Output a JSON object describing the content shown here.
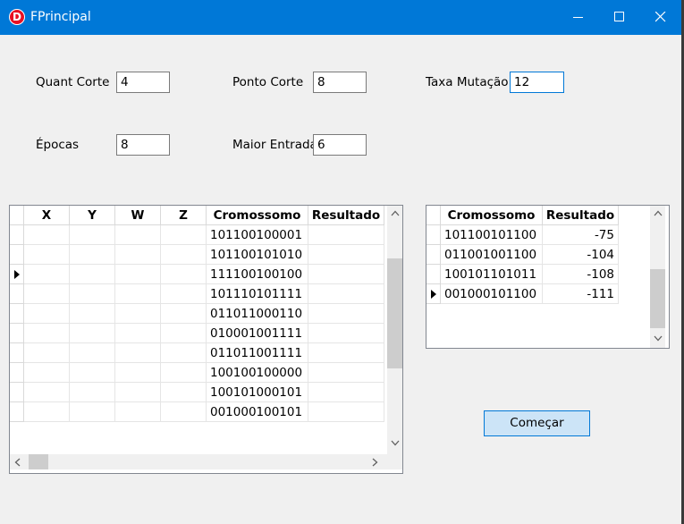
{
  "window": {
    "title": "FPrincipal",
    "icon": "app-d-icon",
    "accent": "#0078d7"
  },
  "form": {
    "quant_corte": {
      "label": "Quant Corte",
      "value": "4"
    },
    "ponto_corte": {
      "label": "Ponto Corte",
      "value": "8"
    },
    "taxa_mutacao": {
      "label": "Taxa Mutação",
      "value": "12"
    },
    "epocas": {
      "label": "Épocas",
      "value": "8"
    },
    "maior_entrada": {
      "label": "Maior Entrada",
      "value": "6"
    }
  },
  "population_grid": {
    "columns": [
      "X",
      "Y",
      "W",
      "Z",
      "Cromossomo",
      "Resultado"
    ],
    "current_row": 2,
    "rows": [
      [
        "",
        "",
        "",
        "",
        "101100100001",
        ""
      ],
      [
        "",
        "",
        "",
        "",
        "101100101010",
        ""
      ],
      [
        "",
        "",
        "",
        "",
        "111100100100",
        ""
      ],
      [
        "",
        "",
        "",
        "",
        "101110101111",
        ""
      ],
      [
        "",
        "",
        "",
        "",
        "011011000110",
        ""
      ],
      [
        "",
        "",
        "",
        "",
        "010001001111",
        ""
      ],
      [
        "",
        "",
        "",
        "",
        "011011001111",
        ""
      ],
      [
        "",
        "",
        "",
        "",
        "100100100000",
        ""
      ],
      [
        "",
        "",
        "",
        "",
        "100101000101",
        ""
      ],
      [
        "",
        "",
        "",
        "",
        "001000100101",
        ""
      ]
    ]
  },
  "result_grid": {
    "columns": [
      "Cromossomo",
      "Resultado"
    ],
    "current_row": 3,
    "rows": [
      [
        "101100101100",
        "-75"
      ],
      [
        "011001001100",
        "-104"
      ],
      [
        "100101101011",
        "-108"
      ],
      [
        "001000101100",
        "-111"
      ]
    ]
  },
  "start_button": {
    "label": "Começar"
  }
}
